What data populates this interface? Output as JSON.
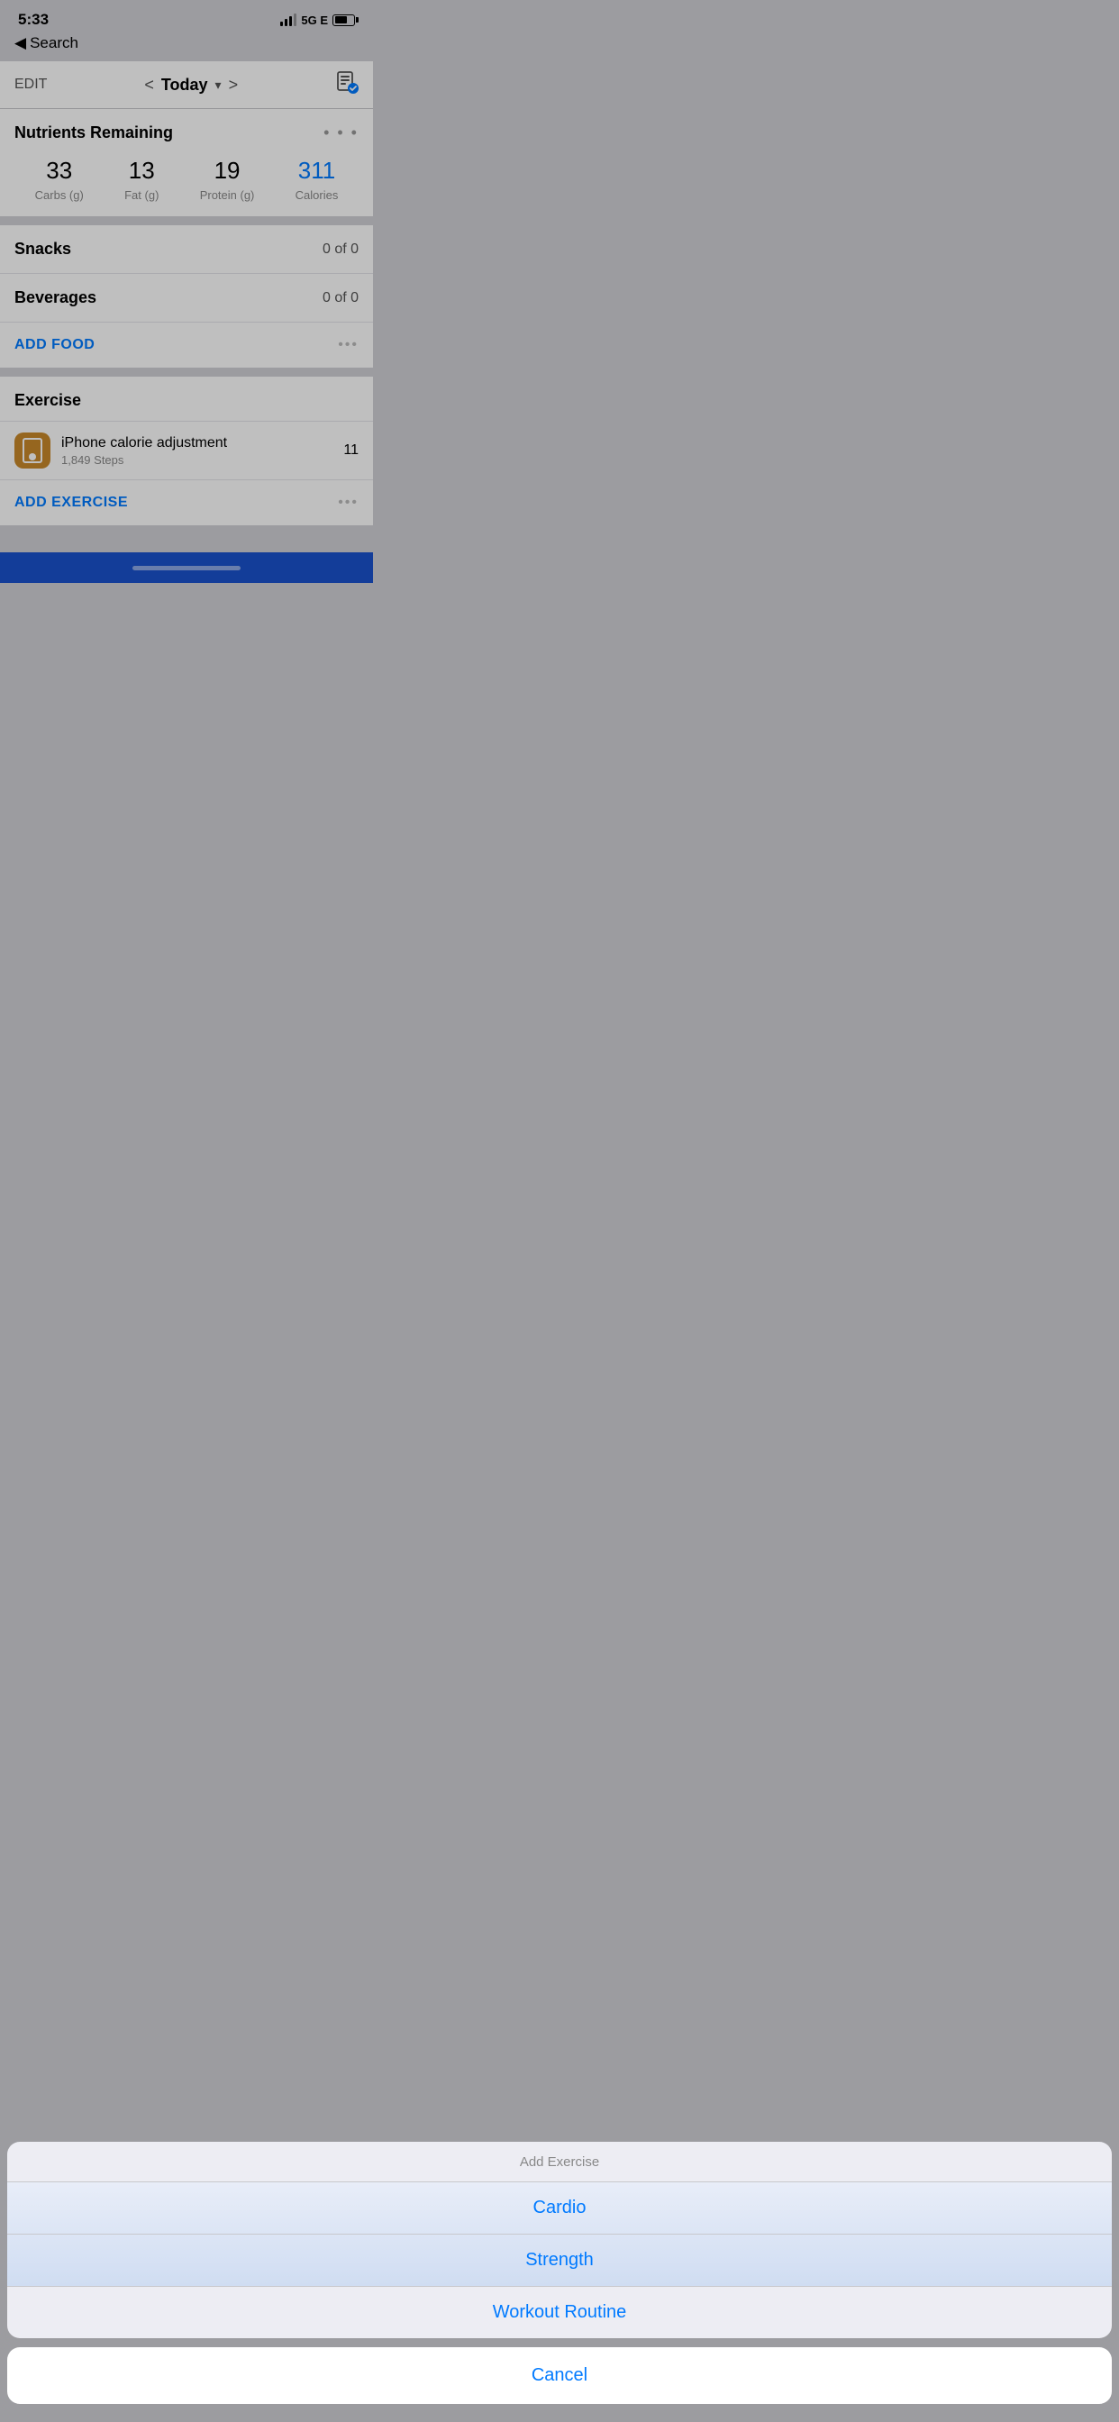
{
  "statusBar": {
    "time": "5:33",
    "network": "5G E",
    "batteryLevel": 65
  },
  "backNav": {
    "arrow": "◀",
    "label": "Search"
  },
  "navBar": {
    "editLabel": "EDIT",
    "prevChevron": "<",
    "title": "Today",
    "dropdownArrow": "▾",
    "nextChevron": ">",
    "iconLabel": "📋"
  },
  "nutrients": {
    "sectionTitle": "Nutrients Remaining",
    "moreIcon": "• • •",
    "items": [
      {
        "value": "33",
        "label": "Carbs (g)"
      },
      {
        "value": "13",
        "label": "Fat (g)"
      },
      {
        "value": "19",
        "label": "Protein (g)"
      },
      {
        "value": "311",
        "label": "Calories",
        "highlight": true
      }
    ]
  },
  "mealSections": [
    {
      "label": "Snacks",
      "value": "0 of 0"
    },
    {
      "label": "Beverages",
      "value": "0 of 0"
    }
  ],
  "addFood": {
    "label": "ADD FOOD",
    "moreIcon": "•••"
  },
  "exercise": {
    "sectionTitle": "Exercise",
    "item": {
      "name": "iPhone calorie adjustment",
      "steps": "1,849 Steps",
      "calories": "11"
    }
  },
  "addExercise": {
    "label": "ADD EXERCISE",
    "moreIcon": "•••"
  },
  "actionSheet": {
    "title": "Add Exercise",
    "options": [
      {
        "label": "Cardio"
      },
      {
        "label": "Strength"
      },
      {
        "label": "Workout Routine"
      }
    ]
  },
  "cancelSheet": {
    "label": "Cancel"
  },
  "colors": {
    "blue": "#007aff",
    "caloriesBlue": "#007aff",
    "exerciseIconBg": "#c8882a",
    "homeBarBg": "#1a52cc"
  }
}
